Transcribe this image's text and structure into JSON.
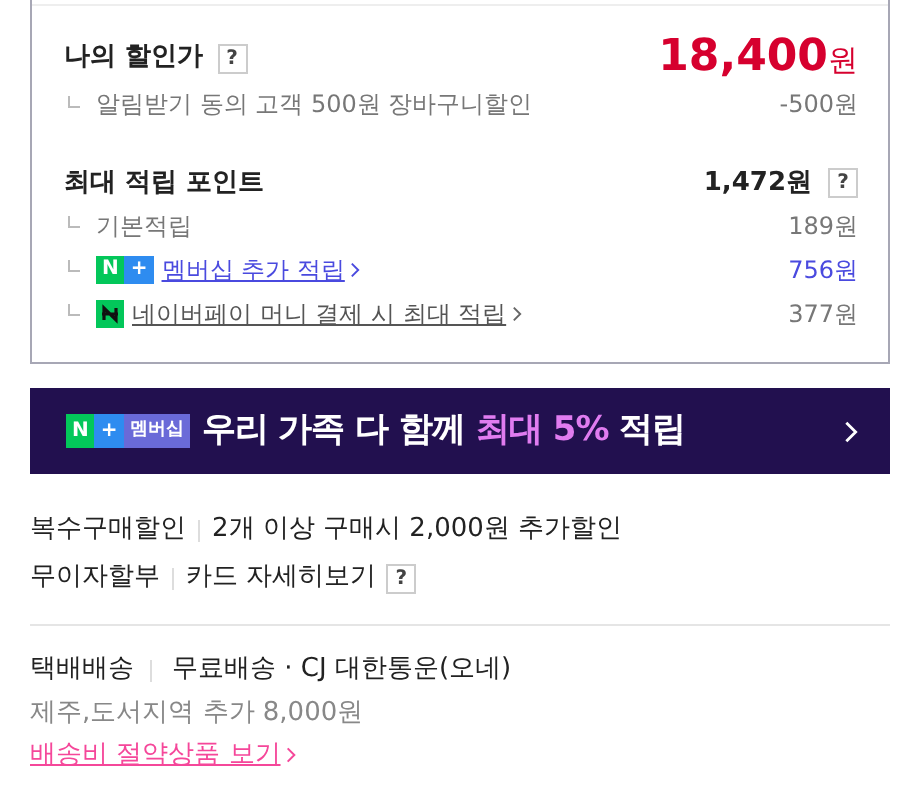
{
  "my_price": {
    "label": "나의 할인가",
    "help": "?",
    "amount": "18,400",
    "unit": "원",
    "items": [
      {
        "label": "알림받기 동의 고객 500원 장바구니할인",
        "value": "-500원"
      }
    ]
  },
  "points": {
    "label": "최대 적립 포인트",
    "amount": "1,472원",
    "help": "?",
    "items": [
      {
        "kind": "plain",
        "label": "기본적립",
        "value": "189원"
      },
      {
        "kind": "membership",
        "badge": [
          "N",
          "+"
        ],
        "label": "멤버십 추가 적립",
        "value": "756원"
      },
      {
        "kind": "pay",
        "label": "네이버페이 머니 결제 시 최대 적립",
        "value": "377원"
      }
    ]
  },
  "banner": {
    "badge": [
      "N",
      "+",
      "멤버십"
    ],
    "parts": [
      {
        "text": "우리 가족 다 함께 ",
        "highlight": false
      },
      {
        "text": "최대 5%",
        "highlight": true
      },
      {
        "text": " 적립",
        "highlight": false
      }
    ]
  },
  "benefits": [
    {
      "label": "복수구매할인",
      "value": "2개 이상 구매시 2,000원 추가할인"
    },
    {
      "label": "무이자할부",
      "value": "카드 자세히보기",
      "help": "?"
    }
  ],
  "shipping": {
    "label": "택배배송",
    "value": "무료배송 · CJ 대한통운(오네)",
    "note": "제주,도서지역 추가 8,000원",
    "link": "배송비 절약상품 보기"
  }
}
